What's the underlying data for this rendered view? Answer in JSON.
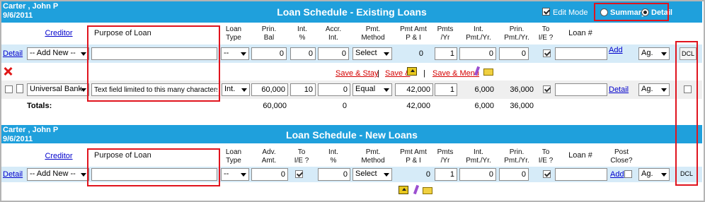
{
  "existing": {
    "person": "Carter , John P",
    "date": "9/6/2011",
    "title": "Loan Schedule - Existing Loans",
    "edit_mode_label": "Edit Mode",
    "summary_label": "Summary",
    "detail_label": "Detail",
    "headers": {
      "creditor": "Creditor",
      "purpose": "Purpose of Loan",
      "loan_type": "Loan\nType",
      "prin_bal": "Prin.\nBal",
      "int_pct": "Int.\n%",
      "accr_int": "Accr.\nInt.",
      "pmt_method": "Pmt.\nMethod",
      "pmt_amt": "Pmt Amt\nP & I",
      "pmts_yr": "Pmts\n/Yr",
      "int_pmt_yr": "Int.\nPmt./Yr.",
      "prin_pmt_yr": "Prin.\nPmt./Yr.",
      "to_ie": "To\nI/E ?",
      "loan_no": "Loan #"
    },
    "new_row": {
      "detail_link": "Detail",
      "creditor_select": "-- Add New --",
      "purpose_value": "",
      "loan_type": "--",
      "prin_bal": "0",
      "int_pct": "0",
      "accr_int": "0",
      "pmt_method": "Select",
      "pmt_amt": "0",
      "pmts_yr": "1",
      "int_pmt_yr": "0",
      "prin_pmt_yr": "0",
      "loan_no": "",
      "add_link": "Add",
      "ag_select": "Ag.",
      "dcl_button": "DCL"
    },
    "actions": {
      "save_stay": "Save & Stay",
      "save_and": "Save &",
      "save_menu": "Save & Menu",
      "sep": "|"
    },
    "loan_row": {
      "creditor": "Universal Bank",
      "purpose": "Text field limited to this many characters >>>",
      "loan_type": "Int.",
      "prin_bal": "60,000",
      "int_pct": "10",
      "accr_int": "0",
      "pmt_method": "Equal",
      "pmt_amt": "42,000",
      "pmts_yr": "1",
      "int_pmt_yr": "6,000",
      "prin_pmt_yr": "36,000",
      "loan_no": "",
      "detail_link": "Detail",
      "ag_select": "Ag."
    },
    "totals": {
      "label": "Totals:",
      "prin_bal": "60,000",
      "accr_int": "0",
      "pmt_amt": "42,000",
      "int_pmt_yr": "6,000",
      "prin_pmt_yr": "36,000"
    }
  },
  "new_loans": {
    "person": "Carter , John P",
    "date": "9/6/2011",
    "title": "Loan Schedule - New Loans",
    "headers": {
      "creditor": "Creditor",
      "purpose": "Purpose of Loan",
      "loan_type": "Loan\nType",
      "adv_amt": "Adv.\nAmt.",
      "to_ie": "To\nI/E ?",
      "int_pct": "Int.\n%",
      "pmt_method": "Pmt.\nMethod",
      "pmt_amt": "Pmt Amt\nP & I",
      "pmts_yr": "Pmts\n/Yr",
      "int_pmt_yr": "Int.\nPmt./Yr.",
      "prin_pmt_yr": "Prin.\nPmt./Yr.",
      "to_ie2": "To\nI/E ?",
      "loan_no": "Loan #",
      "post_close": "Post\nClose?"
    },
    "new_row": {
      "detail_link": "Detail",
      "creditor_select": "-- Add New --",
      "purpose_value": "",
      "loan_type": "--",
      "adv_amt": "0",
      "int_pct": "0",
      "pmt_method": "Select",
      "pmt_amt": "0",
      "pmts_yr": "1",
      "int_pmt_yr": "0",
      "prin_pmt_yr": "0",
      "loan_no": "",
      "add_label": "Add",
      "ag_select": "Ag.",
      "dcl_label": "DCL"
    }
  }
}
